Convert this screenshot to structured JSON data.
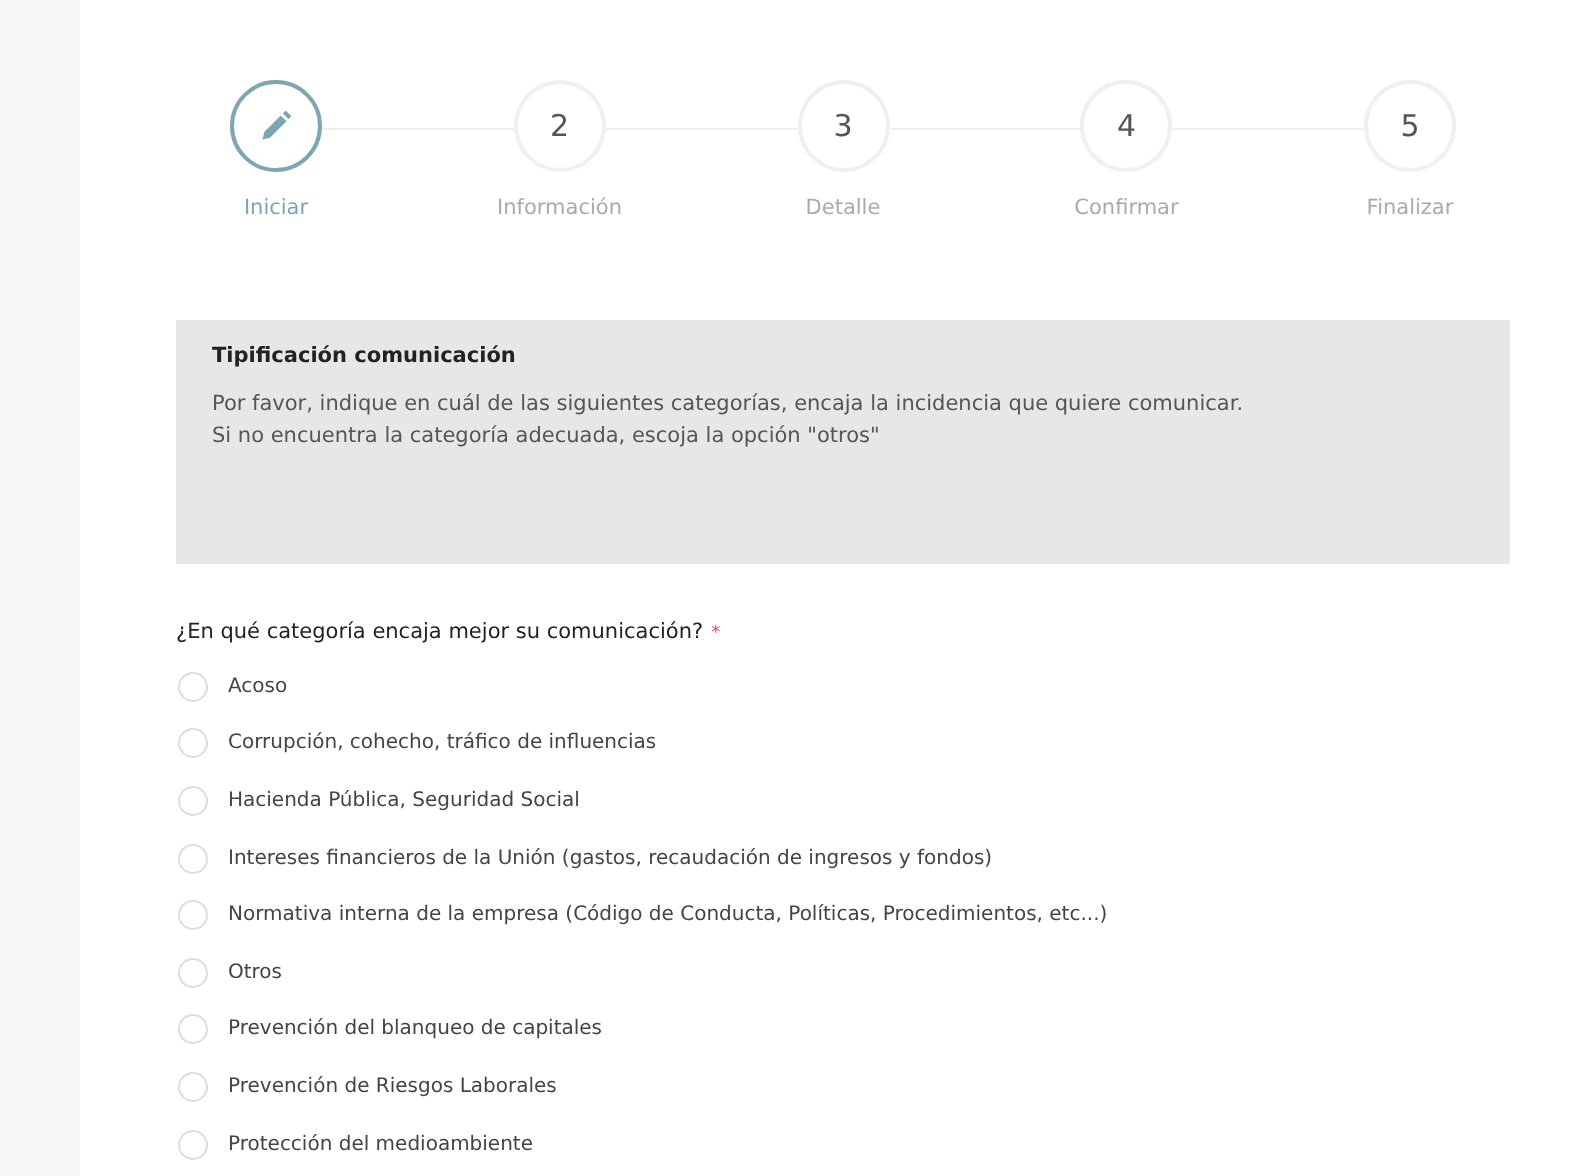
{
  "steps": [
    {
      "label": "Iniciar",
      "selected": true
    },
    {
      "number": "2",
      "label": "Información",
      "selected": false
    },
    {
      "number": "3",
      "label": "Detalle",
      "selected": false
    },
    {
      "number": "4",
      "label": "Confirmar",
      "selected": false
    },
    {
      "number": "5",
      "label": "Finalizar",
      "selected": false
    }
  ],
  "info": {
    "title": "Tipificación comunicación",
    "lines": [
      "Por favor, indique en cuál de las siguientes categorías, encaja la incidencia que quiere comunicar.",
      "Si no encuentra la categoría adecuada, escoja la opción \"otros\""
    ]
  },
  "question": {
    "label": "¿En qué categoría encaja mejor su comunicación?",
    "required_mark": "*"
  },
  "options": [
    {
      "label": "Acoso",
      "selected": false
    },
    {
      "label": "Corrupción, cohecho, tráfico de influencias",
      "selected": false
    },
    {
      "label": "Hacienda Pública, Seguridad Social",
      "selected": false
    },
    {
      "label": "Intereses financieros de la Unión (gastos, recaudación de ingresos y fondos)",
      "selected": false
    },
    {
      "label": "Normativa interna de la empresa (Código de Conducta, Políticas, Procedimientos, etc...)",
      "selected": false
    },
    {
      "label": "Otros",
      "selected": false
    },
    {
      "label": "Prevención del blanqueo de capitales",
      "selected": false
    },
    {
      "label": "Prevención de Riesgos Laborales",
      "selected": false
    },
    {
      "label": "Protección del medioambiente",
      "selected": false
    }
  ]
}
